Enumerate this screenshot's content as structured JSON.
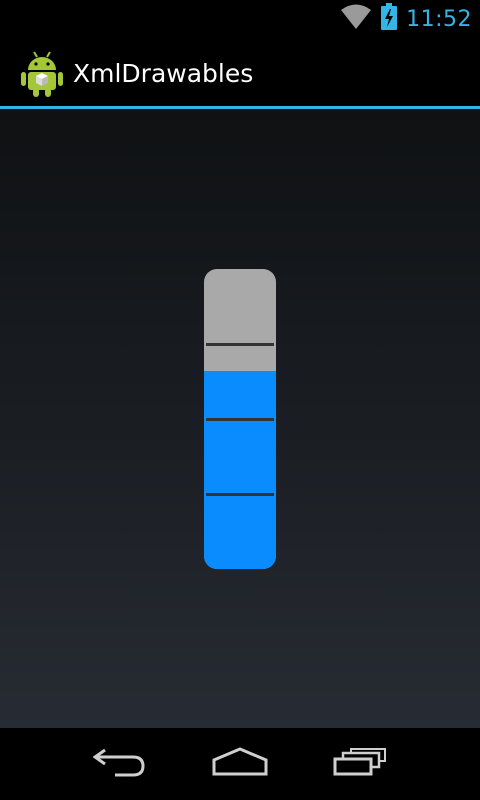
{
  "status_bar": {
    "time": "11:52",
    "icons": [
      "wifi-icon",
      "battery-charging-icon"
    ]
  },
  "action_bar": {
    "icon": "android-app-icon",
    "title": "XmlDrawables",
    "accent_color": "#33b5e5"
  },
  "content": {
    "level_gauge": {
      "level": 0.66,
      "tick_count": 3,
      "fill_color": "#0a8cff",
      "track_color": "#a9a9a9"
    }
  },
  "nav_bar": {
    "buttons": [
      "back-icon",
      "home-icon",
      "recent-apps-icon"
    ]
  }
}
